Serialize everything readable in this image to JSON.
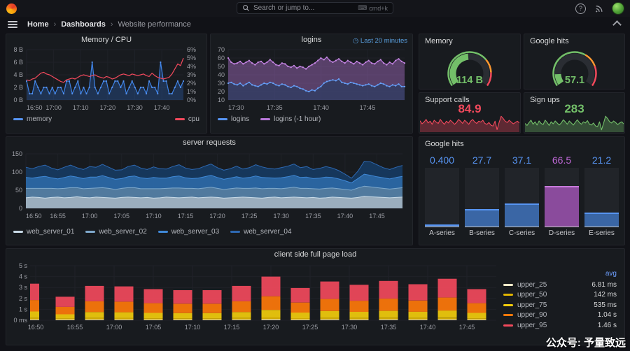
{
  "nav": {
    "search_placeholder": "Search or jump to...",
    "search_shortcut": "cmd+k",
    "breadcrumb": [
      "Home",
      "Dashboards",
      "Website performance"
    ]
  },
  "watermark": "公众号: 予量致远",
  "panels": {
    "memory_cpu": {
      "title": "Memory / CPU",
      "yticks_left": [
        "0 B",
        "2 B",
        "4 B",
        "6 B",
        "8 B"
      ],
      "yticks_right": [
        "0%",
        "1%",
        "2%",
        "3%",
        "4%",
        "5%",
        "6%"
      ],
      "xticks": [
        "16:50",
        "17:00",
        "17:10",
        "17:20",
        "17:30",
        "17:40"
      ],
      "ylim_left": [
        0,
        8
      ],
      "ylim_right": [
        0,
        6
      ],
      "legend": [
        {
          "label": "memory",
          "color": "#5794F2"
        },
        {
          "label": "cpu",
          "color": "#F2495C"
        }
      ],
      "memory_values": [
        3,
        1,
        1,
        3,
        2,
        1,
        2,
        2,
        1,
        2,
        1,
        2,
        2,
        1,
        3,
        3,
        1,
        2,
        3,
        1,
        2,
        1,
        2,
        6,
        2,
        1,
        2,
        3,
        3,
        1,
        2,
        3,
        3,
        2,
        3,
        1,
        2,
        3,
        2,
        1,
        2,
        2,
        1,
        3,
        2,
        2,
        1,
        6,
        3,
        3,
        1,
        1,
        2,
        3,
        2,
        3
      ],
      "cpu_values": [
        2.4,
        2.3,
        2.5,
        2.6,
        2.9,
        3.2,
        3.3,
        3.1,
        3.0,
        2.8,
        2.6,
        2.4,
        2.2,
        2.1,
        2.4,
        2.5,
        2.6,
        2.5,
        2.7,
        2.9,
        3.0,
        2.9,
        2.8,
        2.9,
        3.0,
        2.8,
        2.7,
        2.6,
        2.8,
        2.7,
        2.5,
        2.6,
        2.8,
        3.0,
        3.1,
        3.0,
        2.9,
        3.1,
        3.0,
        2.9,
        3.0,
        3.1,
        2.9,
        2.8,
        3.2,
        2.9,
        2.7,
        2.6,
        2.5,
        2.6,
        2.7,
        3.1,
        3.7,
        4.3,
        4.1,
        5.0
      ]
    },
    "logins": {
      "title": "logins",
      "time_range": "Last 20 minutes",
      "yticks": [
        "10",
        "20",
        "30",
        "40",
        "50",
        "60",
        "70"
      ],
      "xticks": [
        "17:30",
        "17:35",
        "17:40",
        "17:45"
      ],
      "ylim": [
        10,
        70
      ],
      "legend": [
        {
          "label": "logins",
          "color": "#5794F2"
        },
        {
          "label": "logins (-1 hour)",
          "color": "#B877D9"
        }
      ],
      "logins_values": [
        30,
        31,
        29,
        28,
        30,
        27,
        29,
        31,
        28,
        27,
        26,
        28,
        30,
        29,
        31,
        30,
        28,
        27,
        29,
        28,
        26,
        25,
        27,
        26,
        24,
        23,
        21,
        20,
        22,
        21,
        24,
        26,
        30,
        32,
        33,
        34,
        33,
        35,
        31,
        30,
        29,
        31,
        30,
        29,
        28,
        27,
        28,
        29,
        27,
        26,
        28,
        30,
        29,
        27,
        26,
        28,
        27,
        29,
        26,
        26
      ],
      "logins_prev_hour_values": [
        60,
        55,
        53,
        54,
        56,
        53,
        55,
        57,
        54,
        52,
        55,
        56,
        53,
        55,
        58,
        55,
        52,
        51,
        54,
        53,
        50,
        49,
        51,
        48,
        50,
        49,
        47,
        50,
        52,
        54,
        57,
        60,
        58,
        61,
        57,
        55,
        57,
        59,
        56,
        54,
        57,
        55,
        53,
        56,
        54,
        52,
        55,
        57,
        54,
        53,
        56,
        58,
        54,
        52,
        55,
        53,
        57,
        59,
        56,
        54
      ]
    },
    "memory_gauge": {
      "title": "Memory",
      "value": "114 B",
      "percent": 0.48,
      "value_color": "#73BF69",
      "thresholds": [
        [
          0.7,
          "#73BF69"
        ],
        [
          0.85,
          "#FF9830"
        ],
        [
          1,
          "#F2495C"
        ]
      ]
    },
    "google_gauge": {
      "title": "Google hits",
      "value": "57.1",
      "percent": 0.13,
      "value_color": "#73BF69",
      "thresholds": [
        [
          0.62,
          "#73BF69"
        ],
        [
          0.78,
          "#FF9830"
        ],
        [
          1,
          "#F2495C"
        ]
      ]
    },
    "support_calls": {
      "title": "Support calls",
      "value": "84.9",
      "color": "#F2495C",
      "values": [
        85,
        78,
        82,
        88,
        80,
        84,
        77,
        86,
        82,
        79,
        88,
        82,
        77,
        84,
        80,
        86,
        82,
        77,
        81,
        88,
        84,
        79,
        86,
        82,
        77,
        84,
        88,
        82,
        79,
        84,
        82,
        86,
        79,
        77,
        81,
        75,
        73,
        84,
        65,
        81,
        95,
        90,
        84,
        81,
        86,
        82,
        78,
        81,
        84,
        80
      ]
    },
    "sign_ups": {
      "title": "Sign ups",
      "value": "283",
      "color": "#73BF69",
      "values": [
        280,
        275,
        282,
        288,
        278,
        284,
        276,
        286,
        280,
        277,
        288,
        282,
        275,
        284,
        279,
        286,
        281,
        276,
        281,
        289,
        284,
        278,
        286,
        281,
        276,
        283,
        289,
        282,
        278,
        284,
        281,
        287,
        278,
        276,
        281,
        274,
        272,
        284,
        264,
        280,
        298,
        292,
        284,
        281,
        286,
        282,
        277,
        281,
        284,
        279
      ]
    },
    "server_requests": {
      "title": "server requests",
      "yticks": [
        "0",
        "50",
        "100",
        "150"
      ],
      "xticks": [
        "16:50",
        "16:55",
        "17:00",
        "17:05",
        "17:10",
        "17:15",
        "17:20",
        "17:25",
        "17:30",
        "17:35",
        "17:40",
        "17:45"
      ],
      "ylim": [
        0,
        150
      ],
      "series": [
        {
          "name": "web_server_01",
          "fill": "#9FB1C0",
          "stroke": "#C9DBE8",
          "values": [
            29,
            31,
            30,
            28,
            30,
            31,
            29,
            30,
            32,
            30,
            29,
            31,
            30,
            29,
            28,
            30,
            31,
            30,
            29,
            30,
            28,
            29,
            31,
            30,
            29,
            30,
            31,
            29,
            30,
            31,
            30,
            28,
            29,
            30,
            31,
            30,
            29,
            28,
            30,
            31,
            29,
            30,
            31,
            30,
            29,
            30,
            28,
            29,
            31,
            30,
            29,
            28,
            30,
            33,
            32,
            31,
            30,
            29,
            30,
            31
          ]
        },
        {
          "name": "web_server_02",
          "fill": "#537B9E",
          "stroke": "#7FA9CC",
          "values": [
            26,
            24,
            25,
            27,
            25,
            23,
            26,
            27,
            25,
            24,
            26,
            25,
            27,
            26,
            24,
            25,
            26,
            27,
            25,
            24,
            26,
            25,
            24,
            26,
            27,
            25,
            24,
            25,
            26,
            27,
            25,
            24,
            25,
            26,
            24,
            25,
            27,
            26,
            25,
            24,
            25,
            26,
            27,
            25,
            26,
            24,
            25,
            26,
            25,
            24,
            23,
            22,
            26,
            28,
            27,
            26,
            25,
            24,
            25,
            26
          ]
        },
        {
          "name": "web_server_03",
          "fill": "#2B66A3",
          "stroke": "#4089D8",
          "values": [
            30,
            28,
            31,
            33,
            29,
            27,
            30,
            32,
            29,
            28,
            31,
            30,
            33,
            30,
            28,
            27,
            30,
            32,
            30,
            28,
            31,
            29,
            28,
            31,
            33,
            29,
            27,
            29,
            31,
            33,
            30,
            28,
            29,
            31,
            28,
            30,
            33,
            31,
            29,
            28,
            30,
            31,
            33,
            30,
            31,
            28,
            30,
            31,
            29,
            27,
            24,
            20,
            26,
            33,
            32,
            30,
            29,
            28,
            30,
            31
          ]
        },
        {
          "name": "web_server_04",
          "fill": "#16395F",
          "stroke": "#2E69B3",
          "values": [
            28,
            26,
            29,
            31,
            27,
            25,
            28,
            30,
            26,
            25,
            29,
            27,
            31,
            28,
            25,
            24,
            28,
            30,
            27,
            25,
            29,
            26,
            25,
            28,
            31,
            27,
            25,
            26,
            29,
            31,
            27,
            25,
            26,
            29,
            25,
            27,
            31,
            29,
            26,
            25,
            28,
            29,
            31,
            27,
            29,
            25,
            27,
            29,
            26,
            23,
            18,
            13,
            20,
            35,
            37,
            33,
            28,
            26,
            28,
            30
          ]
        }
      ]
    },
    "google_hits_bars": {
      "title": "Google hits",
      "max": 100,
      "bars": [
        {
          "label": "A-series",
          "value": "0.400",
          "num": 0.4,
          "color": "#3A66A5",
          "color_top": "#5794F2",
          "value_color": "#5794F2"
        },
        {
          "label": "B-series",
          "value": "27.7",
          "num": 27.7,
          "color": "#3A66A5",
          "color_top": "#5794F2",
          "value_color": "#5794F2"
        },
        {
          "label": "C-series",
          "value": "37.1",
          "num": 37.1,
          "color": "#3A66A5",
          "color_top": "#5794F2",
          "value_color": "#5794F2"
        },
        {
          "label": "D-series",
          "value": "66.5",
          "num": 66.5,
          "color": "#8A4B9C",
          "color_top": "#C77ADB",
          "value_color": "#C069D8"
        },
        {
          "label": "E-series",
          "value": "21.2",
          "num": 21.2,
          "color": "#3A66A5",
          "color_top": "#5794F2",
          "value_color": "#5794F2"
        }
      ]
    },
    "client_load": {
      "title": "client side full page load",
      "yticks": [
        "0 ms",
        "1 s",
        "2 s",
        "3 s",
        "4 s",
        "5 s"
      ],
      "xticks": [
        "16:50",
        "16:55",
        "17:00",
        "17:05",
        "17:10",
        "17:15",
        "17:20",
        "17:25",
        "17:30",
        "17:35",
        "17:40",
        "17:45"
      ],
      "ylim_seconds": [
        0,
        5
      ],
      "legend_header": "avg",
      "legend": [
        {
          "label": "upper_25",
          "avg": "6.81 ms",
          "color": "#F5EBCB"
        },
        {
          "label": "upper_50",
          "avg": "142 ms",
          "color": "#E0B400"
        },
        {
          "label": "upper_75",
          "avg": "535 ms",
          "color": "#F2CC0C"
        },
        {
          "label": "upper_90",
          "avg": "1.04 s",
          "color": "#FF780A"
        },
        {
          "label": "upper_95",
          "avg": "1.46 s",
          "color": "#F2495C"
        }
      ],
      "bar_segments_seconds": [
        [
          0.07,
          0.15,
          0.58,
          1.05,
          1.5
        ],
        [
          0.06,
          0.1,
          0.38,
          0.68,
          0.93
        ],
        [
          0.07,
          0.14,
          0.54,
          0.99,
          1.41
        ],
        [
          0.07,
          0.13,
          0.53,
          0.97,
          1.4
        ],
        [
          0.06,
          0.12,
          0.49,
          0.89,
          1.29
        ],
        [
          0.06,
          0.12,
          0.47,
          0.86,
          1.24
        ],
        [
          0.06,
          0.12,
          0.47,
          0.86,
          1.24
        ],
        [
          0.07,
          0.14,
          0.54,
          0.99,
          1.41
        ],
        [
          0.09,
          0.17,
          0.69,
          1.25,
          1.8
        ],
        [
          0.06,
          0.13,
          0.51,
          0.92,
          1.33
        ],
        [
          0.08,
          0.15,
          0.61,
          1.11,
          1.6
        ],
        [
          0.07,
          0.14,
          0.56,
          1.02,
          1.46
        ],
        [
          0.08,
          0.16,
          0.62,
          1.12,
          1.62
        ],
        [
          0.07,
          0.14,
          0.57,
          1.03,
          1.49
        ],
        [
          0.08,
          0.16,
          0.65,
          1.19,
          1.72
        ],
        [
          0.06,
          0.12,
          0.49,
          0.89,
          1.29
        ]
      ]
    }
  }
}
